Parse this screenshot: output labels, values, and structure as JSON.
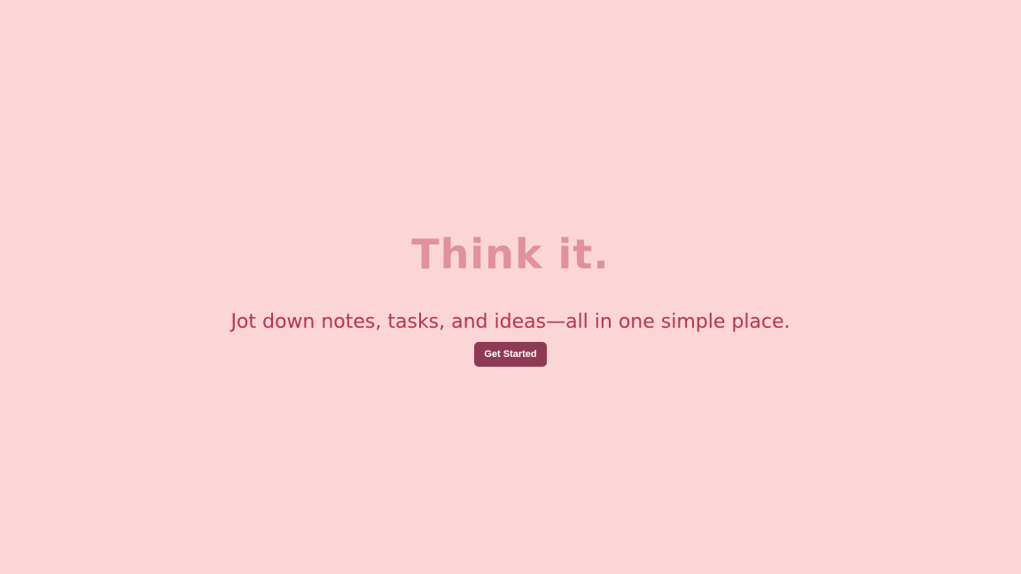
{
  "hero": {
    "logo_text": "Think it.",
    "tagline": "Jot down notes, tasks, and ideas—all in one simple place.",
    "cta_label": "Get Started"
  },
  "colors": {
    "background": "#fcd6d6",
    "logo": "#e0919c",
    "tagline": "#b8334f",
    "button": "#8e3a55",
    "button_text": "#ffffff"
  }
}
